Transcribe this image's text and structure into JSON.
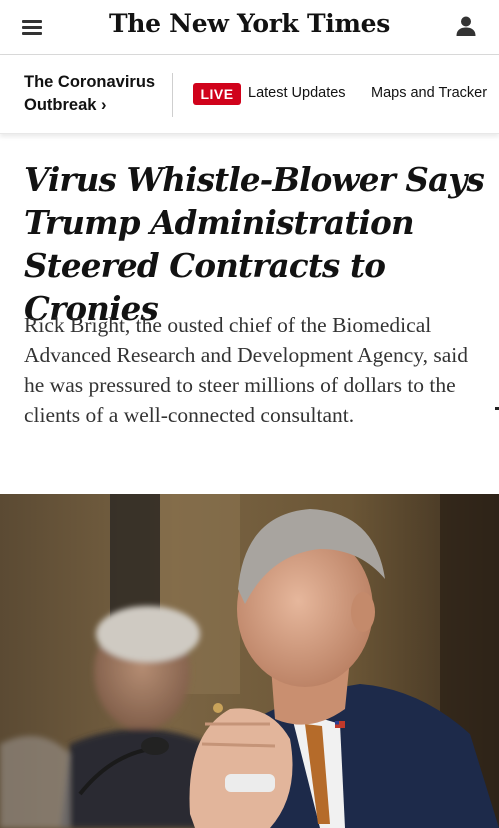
{
  "header": {
    "masthead": "The New York Times",
    "menu_icon": "hamburger-menu-icon",
    "account_icon": "user-account-icon"
  },
  "subnav": {
    "section_line1": "The Coronavirus",
    "section_line2": "Outbreak",
    "section_chevron": "›",
    "live_label": "LIVE",
    "links": [
      "Latest Updates",
      "Maps and Tracker"
    ]
  },
  "article": {
    "headline": "Virus Whistle-Blower Says Trump Administration Steered Contracts to Cronies",
    "summary": "Rick Bright, the ousted chief of the Biomedical Advanced Research and Development Agency, said he was pressured to steer millions of dollars to the clients of a well-connected consultant."
  },
  "colors": {
    "live_red": "#d0021b",
    "text": "#121212",
    "summary_text": "#333333"
  }
}
